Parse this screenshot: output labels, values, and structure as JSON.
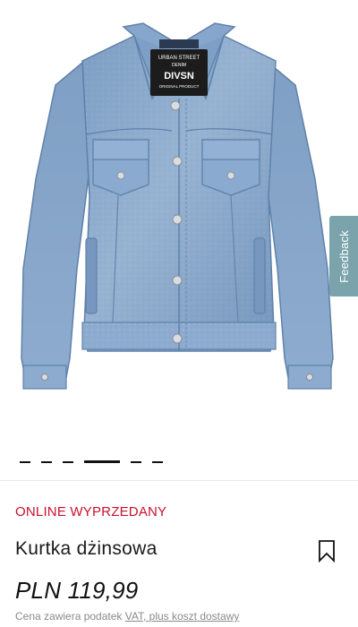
{
  "product": {
    "status": "ONLINE WYPRZEDANY",
    "title": "Kurtka dżinsowa",
    "price": "PLN 119,99",
    "tax_note_prefix": "Cena zawiera podatek ",
    "tax_note_link": "VAT, plus koszt dostawy",
    "image_label": {
      "brand_line1": "URBAN STREET",
      "brand_line2": "DENIM",
      "brand_main": "DIVSN",
      "brand_line3": "ORIGINAL PRODUCT"
    }
  },
  "gallery": {
    "image_count": 6,
    "active_index": 3
  },
  "feedback": {
    "label": "Feedback"
  },
  "icons": {
    "wishlist": "bookmark-icon"
  },
  "colors": {
    "status": "#c8102e",
    "feedback_bg": "#7aa3ab",
    "denim": "#86a6c8"
  }
}
